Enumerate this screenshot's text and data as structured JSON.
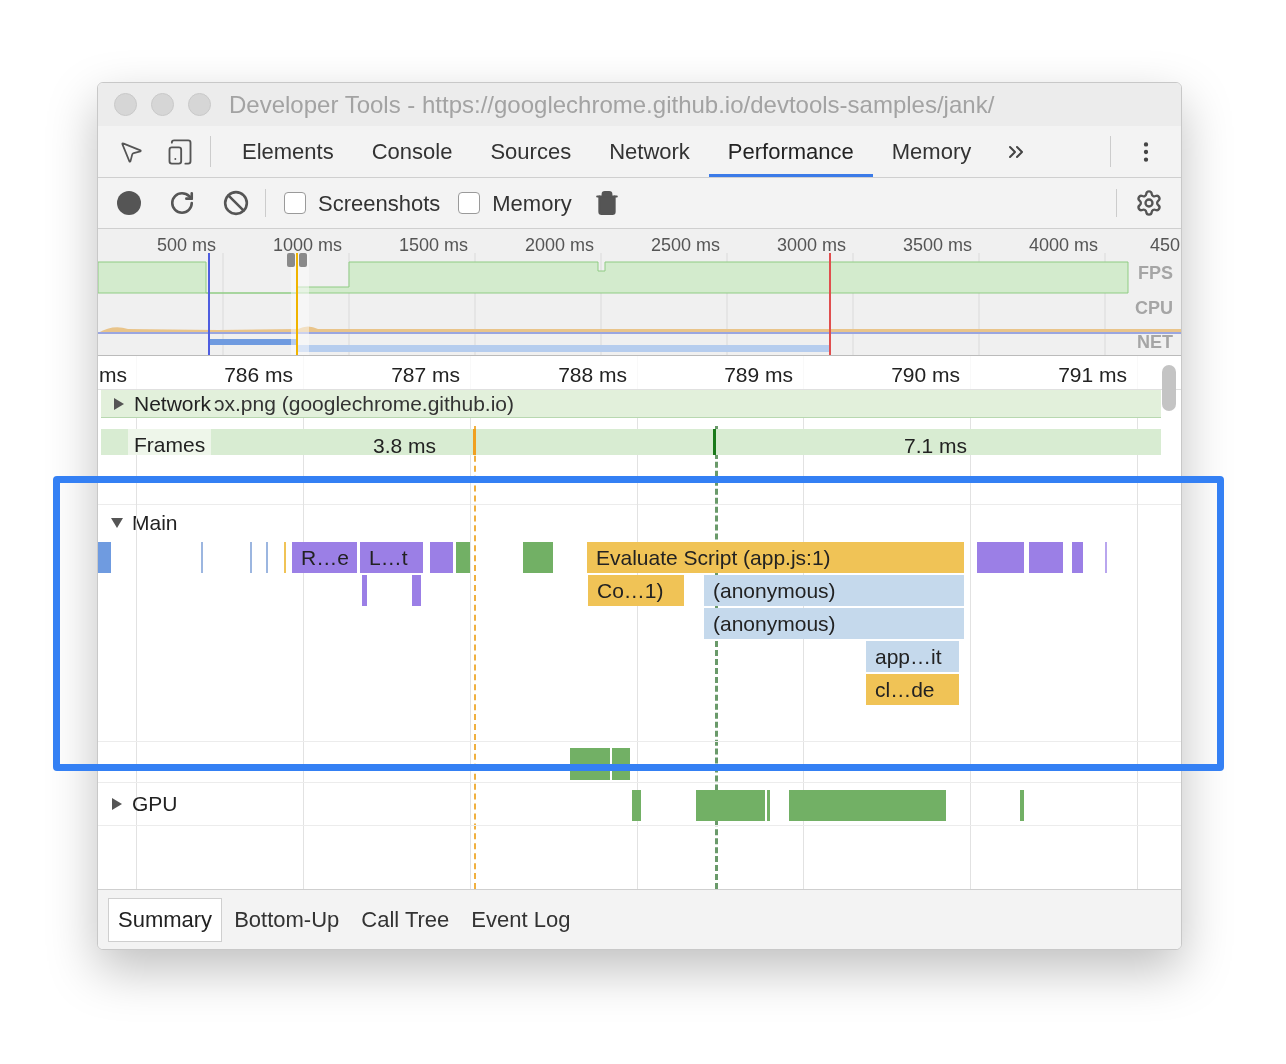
{
  "window": {
    "title": "Developer Tools - https://googlechrome.github.io/devtools-samples/jank/"
  },
  "tabs": [
    {
      "label": "Elements",
      "selected": false
    },
    {
      "label": "Console",
      "selected": false
    },
    {
      "label": "Sources",
      "selected": false
    },
    {
      "label": "Network",
      "selected": false
    },
    {
      "label": "Performance",
      "selected": true
    },
    {
      "label": "Memory",
      "selected": false
    }
  ],
  "toolbar": {
    "checkboxes": [
      {
        "label": "Screenshots",
        "checked": false
      },
      {
        "label": "Memory",
        "checked": false
      }
    ]
  },
  "overview": {
    "ticks": [
      "500 ms",
      "1000 ms",
      "1500 ms",
      "2000 ms",
      "2500 ms",
      "3000 ms",
      "3500 ms",
      "4000 ms",
      "450"
    ],
    "lanes": [
      "FPS",
      "CPU",
      "NET"
    ]
  },
  "ruler": {
    "ticks": [
      "ms",
      "786 ms",
      "787 ms",
      "788 ms",
      "789 ms",
      "790 ms",
      "791 ms"
    ]
  },
  "network": {
    "label": "Network",
    "expanded": false,
    "request": "ɔx.png (googlechrome.github.io)"
  },
  "frames": {
    "label": "Frames",
    "durations": [
      "3.8 ms",
      "7.1 ms"
    ]
  },
  "main": {
    "label": "Main",
    "expanded": true,
    "events": [
      {
        "label": "R…e",
        "kind": "rendering"
      },
      {
        "label": "L…t",
        "kind": "rendering"
      },
      {
        "label": "Evaluate Script (app.js:1)",
        "kind": "scripting"
      },
      {
        "label": "Co…1)",
        "kind": "scripting"
      },
      {
        "label": "(anonymous)",
        "kind": "function"
      },
      {
        "label": "(anonymous)",
        "kind": "function"
      },
      {
        "label": "app…it",
        "kind": "function"
      },
      {
        "label": "cl…de",
        "kind": "scripting"
      }
    ]
  },
  "gpu": {
    "label": "GPU",
    "expanded": false
  },
  "details_tabs": [
    {
      "label": "Summary",
      "selected": true
    },
    {
      "label": "Bottom-Up",
      "selected": false
    },
    {
      "label": "Call Tree",
      "selected": false
    },
    {
      "label": "Event Log",
      "selected": false
    }
  ]
}
